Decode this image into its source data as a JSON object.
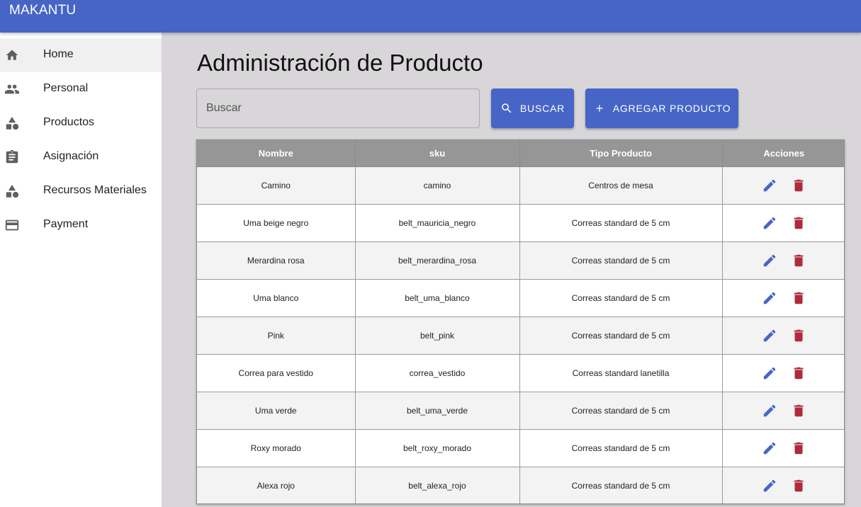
{
  "app": {
    "brand": "MAKANTU",
    "accent": "#4665c6"
  },
  "sidebar": {
    "items": [
      {
        "label": "Home",
        "icon": "home-icon",
        "active": true
      },
      {
        "label": "Personal",
        "icon": "people-icon",
        "active": false
      },
      {
        "label": "Productos",
        "icon": "category-icon",
        "active": false
      },
      {
        "label": "Asignación",
        "icon": "assignment-icon",
        "active": false
      },
      {
        "label": "Recursos Materiales",
        "icon": "category-icon",
        "active": false
      },
      {
        "label": "Payment",
        "icon": "credit-card-icon",
        "active": false
      }
    ]
  },
  "main": {
    "title": "Administración de Producto",
    "search": {
      "placeholder": "Buscar",
      "value": ""
    },
    "search_button": "BUSCAR",
    "add_button": "AGREGAR PRODUCTO"
  },
  "table": {
    "headers": [
      "Nombre",
      "sku",
      "Tipo Producto",
      "Acciones"
    ],
    "rows": [
      {
        "nombre": "Camino",
        "sku": "camino",
        "tipo": "Centros de mesa"
      },
      {
        "nombre": "Uma beige negro",
        "sku": "belt_mauricia_negro",
        "tipo": "Correas standard de 5 cm"
      },
      {
        "nombre": "Merardina rosa",
        "sku": "belt_merardina_rosa",
        "tipo": "Correas standard de 5 cm"
      },
      {
        "nombre": "Uma blanco",
        "sku": "belt_uma_blanco",
        "tipo": "Correas standard de 5 cm"
      },
      {
        "nombre": "Pink",
        "sku": "belt_pink",
        "tipo": "Correas standard de 5 cm"
      },
      {
        "nombre": "Correa para vestido",
        "sku": "correa_vestido",
        "tipo": "Correas standard lanetilla"
      },
      {
        "nombre": "Uma verde",
        "sku": "belt_uma_verde",
        "tipo": "Correas standard de 5 cm"
      },
      {
        "nombre": "Roxy morado",
        "sku": "belt_roxy_morado",
        "tipo": "Correas standard de 5 cm"
      },
      {
        "nombre": "Alexa rojo",
        "sku": "belt_alexa_rojo",
        "tipo": "Correas standard de 5 cm"
      }
    ],
    "edit_color": "#4665c6",
    "delete_color": "#b02a3a"
  }
}
